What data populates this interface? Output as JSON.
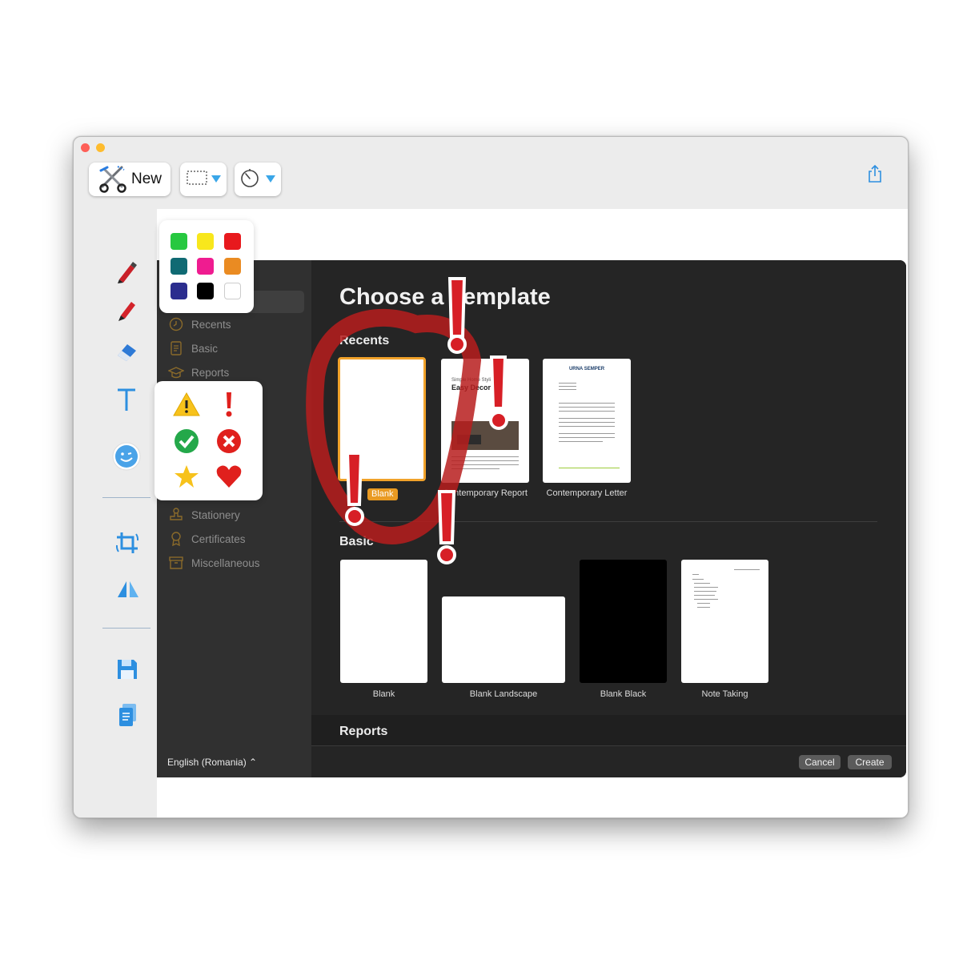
{
  "toolbar": {
    "new_label": "New",
    "new_icon": "scissors-icon",
    "capture_mode_icon": "rectangle-selection-icon",
    "timer_icon": "timer-icon",
    "share_icon": "share-icon"
  },
  "left_tools": [
    "marker-icon",
    "pen-icon",
    "eraser-icon",
    "text-icon",
    "emoji-icon",
    "crop-rotate-icon",
    "flip-icon",
    "save-icon",
    "copy-icon"
  ],
  "color_palette": [
    "#27c840",
    "#f8e71c",
    "#e8191d",
    "#106a73",
    "#ef1c90",
    "#ea8b22",
    "#2b2d8e",
    "#000000",
    "#ffffff"
  ],
  "stickers": [
    "warning-icon",
    "exclamation-icon",
    "checkmark-icon",
    "cross-icon",
    "star-icon",
    "heart-icon"
  ],
  "dialog": {
    "title": "Choose a Template",
    "sidebar": {
      "items": [
        {
          "label": "Recents",
          "icon": "clock-icon"
        },
        {
          "label": "Basic",
          "icon": "document-icon"
        },
        {
          "label": "Reports",
          "icon": "graduation-cap-icon"
        },
        {
          "label": "Stationery",
          "icon": "stamp-icon"
        },
        {
          "label": "Certificates",
          "icon": "ribbon-icon"
        },
        {
          "label": "Miscellaneous",
          "icon": "archive-icon"
        }
      ],
      "language": "English (Romania) ⌃"
    },
    "recents": {
      "heading": "Recents",
      "items": [
        {
          "label": "Blank"
        },
        {
          "label": "Contemporary Report",
          "preview_text": [
            "Simple Home Styling",
            "Easy Decor"
          ]
        },
        {
          "label": "Contemporary Letter",
          "preview_text": [
            "URNA SEMPER"
          ]
        }
      ]
    },
    "basic": {
      "heading": "Basic",
      "items": [
        {
          "label": "Blank"
        },
        {
          "label": "Blank Landscape"
        },
        {
          "label": "Blank Black"
        },
        {
          "label": "Note Taking"
        }
      ]
    },
    "reports_heading": "Reports",
    "cancel_label": "Cancel",
    "create_label": "Create"
  },
  "annotations": {
    "circle_color": "#b71d1d",
    "exclamation_color": "#d71f26"
  }
}
